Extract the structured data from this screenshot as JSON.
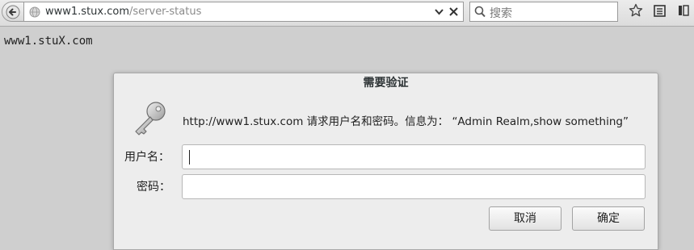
{
  "toolbar": {
    "url_host": "www1.stux.com",
    "url_path": "/server-status",
    "search_placeholder": "搜索"
  },
  "page": {
    "host_text": "www1.stuX.com"
  },
  "dialog": {
    "title": "需要验证",
    "message": "http://www1.stux.com 请求用户名和密码。信息为： “Admin Realm,show something”",
    "username_label": "用户名：",
    "password_label": "密码：",
    "username_value": "",
    "password_value": "",
    "cancel_label": "取消",
    "ok_label": "确定"
  },
  "icons": {
    "back": "back-arrow-icon",
    "globe": "globe-icon",
    "dropdown": "chevron-down-icon",
    "stop": "close-icon",
    "search": "search-icon",
    "star": "star-icon",
    "reading_list": "reading-list-icon",
    "more": "more-icon",
    "key": "key-icon"
  }
}
